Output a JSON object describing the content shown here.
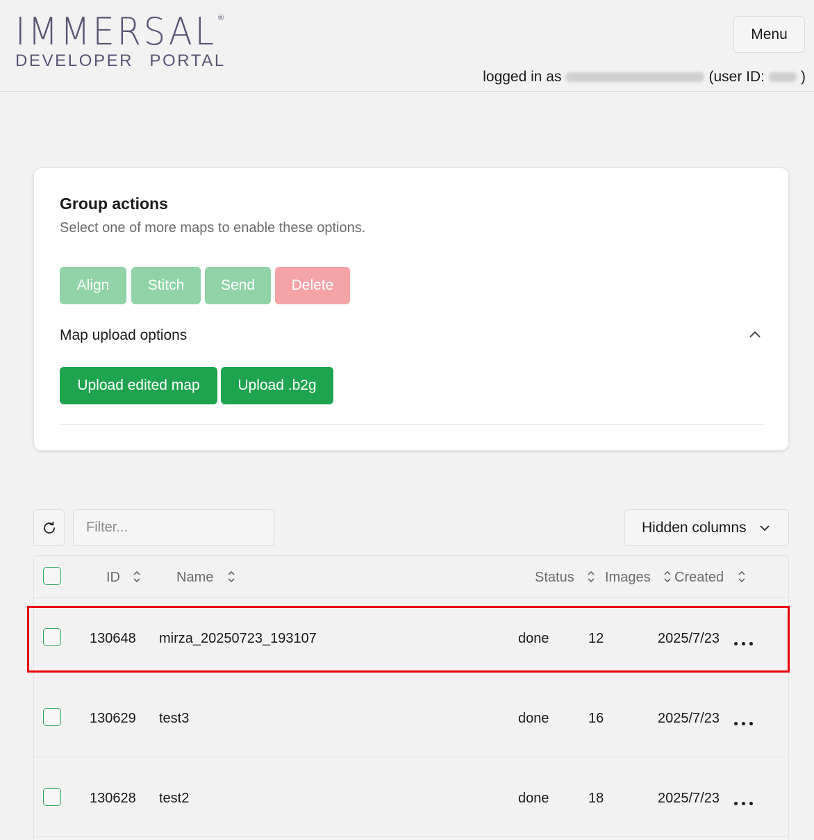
{
  "header": {
    "logo_main": "IMMERSAL",
    "logo_reg": "®",
    "logo_sub": "DEVELOPER PORTAL",
    "menu_label": "Menu",
    "login_prefix": "logged in as",
    "login_user_prefix": "(user ID:",
    "login_suffix": ")"
  },
  "group_actions": {
    "title": "Group actions",
    "subtitle": "Select one of more maps to enable these options.",
    "align_label": "Align",
    "stitch_label": "Stitch",
    "send_label": "Send",
    "delete_label": "Delete"
  },
  "upload": {
    "title": "Map upload options",
    "edited_label": "Upload edited map",
    "b2g_label": "Upload .b2g"
  },
  "toolbar": {
    "filter_placeholder": "Filter...",
    "hidden_columns_label": "Hidden columns"
  },
  "table": {
    "columns": [
      "ID",
      "Name",
      "Status",
      "Images",
      "Created"
    ],
    "rows": [
      {
        "id": "130648",
        "name": "mirza_20250723_193107",
        "status": "done",
        "images": "12",
        "created": "2025/7/23"
      },
      {
        "id": "130629",
        "name": "test3",
        "status": "done",
        "images": "16",
        "created": "2025/7/23"
      },
      {
        "id": "130628",
        "name": "test2",
        "status": "done",
        "images": "18",
        "created": "2025/7/23"
      }
    ]
  },
  "colors": {
    "accent_green": "#1ea44f",
    "disabled_green": "#8fd3a6",
    "disabled_red": "#f4a3a6",
    "highlight_red": "#e8000b"
  }
}
